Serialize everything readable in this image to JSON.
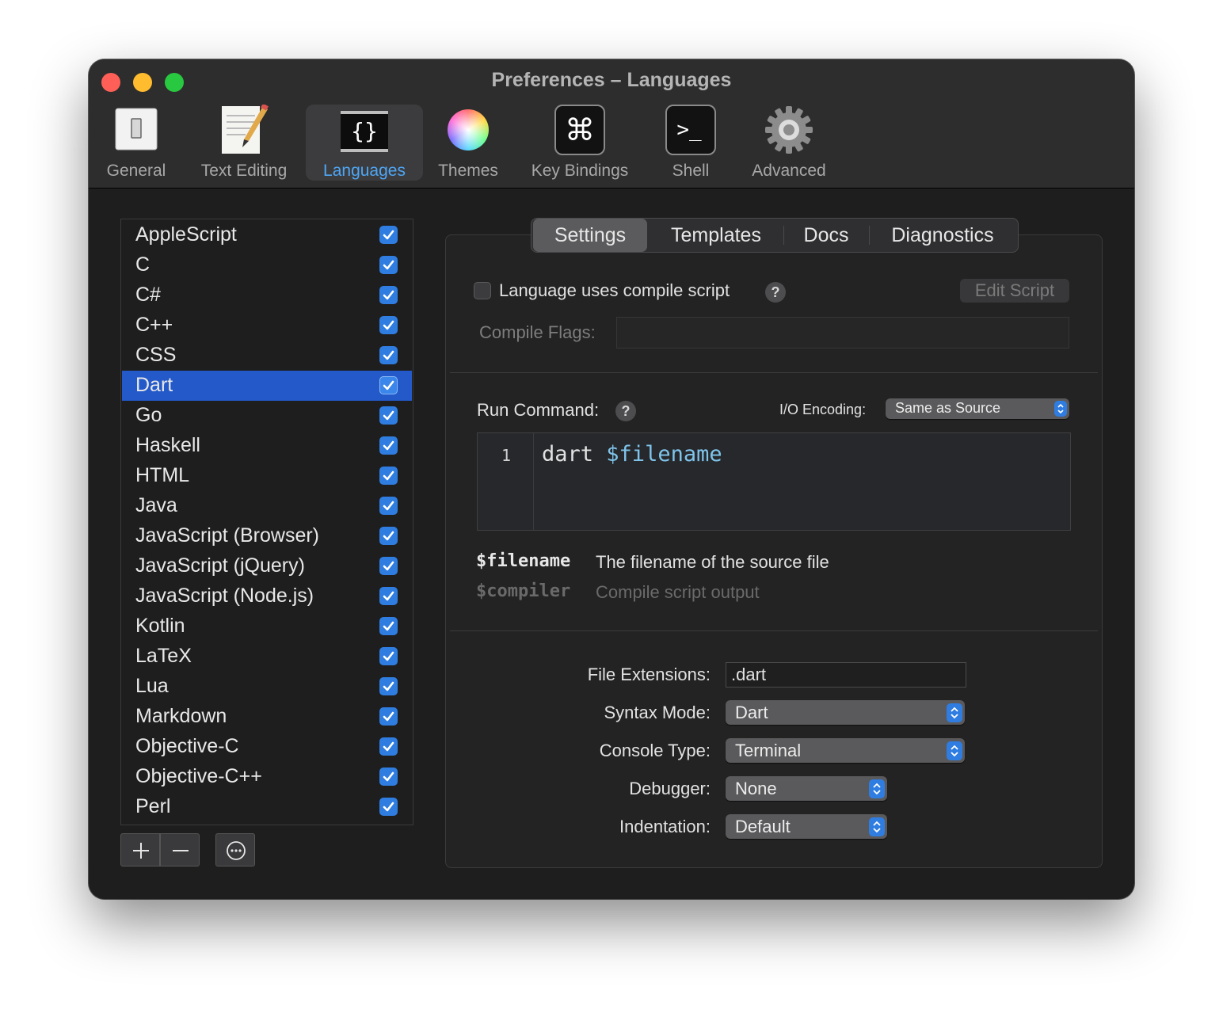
{
  "window": {
    "title": "Preferences – Languages"
  },
  "toolbar": [
    {
      "label": "General",
      "icon": "general-icon"
    },
    {
      "label": "Text Editing",
      "icon": "text-editing-icon"
    },
    {
      "label": "Languages",
      "icon": "languages-icon",
      "active": true
    },
    {
      "label": "Themes",
      "icon": "themes-icon"
    },
    {
      "label": "Key Bindings",
      "icon": "key-bindings-icon"
    },
    {
      "label": "Shell",
      "icon": "shell-icon"
    },
    {
      "label": "Advanced",
      "icon": "advanced-icon"
    }
  ],
  "languages": [
    {
      "name": "AppleScript",
      "enabled": true
    },
    {
      "name": "C",
      "enabled": true
    },
    {
      "name": "C#",
      "enabled": true
    },
    {
      "name": "C++",
      "enabled": true
    },
    {
      "name": "CSS",
      "enabled": true
    },
    {
      "name": "Dart",
      "enabled": true,
      "selected": true
    },
    {
      "name": "Go",
      "enabled": true
    },
    {
      "name": "Haskell",
      "enabled": true
    },
    {
      "name": "HTML",
      "enabled": true
    },
    {
      "name": "Java",
      "enabled": true
    },
    {
      "name": "JavaScript (Browser)",
      "enabled": true
    },
    {
      "name": "JavaScript (jQuery)",
      "enabled": true
    },
    {
      "name": "JavaScript (Node.js)",
      "enabled": true
    },
    {
      "name": "Kotlin",
      "enabled": true
    },
    {
      "name": "LaTeX",
      "enabled": true
    },
    {
      "name": "Lua",
      "enabled": true
    },
    {
      "name": "Markdown",
      "enabled": true
    },
    {
      "name": "Objective-C",
      "enabled": true
    },
    {
      "name": "Objective-C++",
      "enabled": true
    },
    {
      "name": "Perl",
      "enabled": true
    }
  ],
  "list_buttons": {
    "add": "+",
    "remove": "−",
    "more": "⋯"
  },
  "tabs": [
    {
      "label": "Settings",
      "active": true
    },
    {
      "label": "Templates"
    },
    {
      "label": "Docs"
    },
    {
      "label": "Diagnostics"
    }
  ],
  "compile": {
    "checkbox_label": "Language uses compile script",
    "checked": false,
    "help": "?",
    "edit_button": "Edit Script",
    "flags_label": "Compile Flags:",
    "flags_value": ""
  },
  "run": {
    "label": "Run Command:",
    "help": "?",
    "encoding_label": "I/O Encoding:",
    "encoding_value": "Same as Source",
    "line_number": "1",
    "command_keyword": "dart",
    "command_variable": "$filename"
  },
  "variables": [
    {
      "name": "$filename",
      "desc": "The filename of the source file"
    },
    {
      "name": "$compiler",
      "desc": "Compile script output"
    }
  ],
  "options": {
    "extensions_label": "File Extensions:",
    "extensions_value": ".dart",
    "syntax_label": "Syntax Mode:",
    "syntax_value": "Dart",
    "console_label": "Console Type:",
    "console_value": "Terminal",
    "debugger_label": "Debugger:",
    "debugger_value": "None",
    "indent_label": "Indentation:",
    "indent_value": "Default"
  },
  "colors": {
    "accent": "#2f7de1",
    "selection": "#2359c9",
    "active_tab_label": "#4ea6f5",
    "variable_highlight": "#7fc4ea"
  }
}
